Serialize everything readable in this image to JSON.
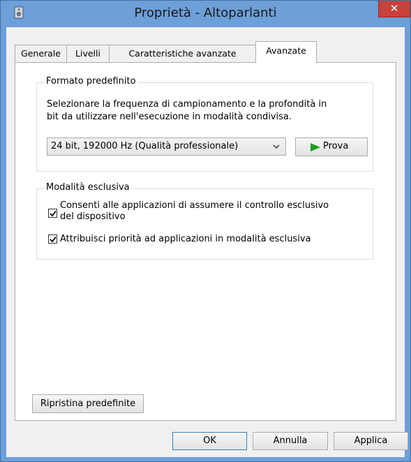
{
  "window": {
    "title": "Proprietà - Altoparlanti",
    "close_glyph": "✕"
  },
  "tabs": [
    {
      "label": "Generale"
    },
    {
      "label": "Livelli"
    },
    {
      "label": "Caratteristiche avanzate"
    },
    {
      "label": "Avanzate",
      "active": true
    }
  ],
  "default_format": {
    "legend": "Formato predefinito",
    "description_line1": "Selezionare la frequenza di campionamento e la profondità in",
    "description_line2": "bit da utilizzare nell'esecuzione in modalità condivisa.",
    "selected_value": "24 bit, 192000 Hz (Qualità professionale)",
    "test_button_label": "Prova",
    "test_icon": "play-icon",
    "play_color": "#1e9e1e"
  },
  "exclusive_mode": {
    "legend": "Modalità esclusiva",
    "options": [
      {
        "line1": "Consenti alle applicazioni di assumere il controllo esclusivo",
        "line2": "del dispositivo",
        "checked": true
      },
      {
        "line1": "Attribuisci priorità ad applicazioni in modalità esclusiva",
        "checked": true
      }
    ]
  },
  "restore_button_label": "Ripristina predefinite",
  "footer": {
    "ok_label": "OK",
    "cancel_label": "Annulla",
    "apply_label": "Applica"
  },
  "colors": {
    "titlebar": "#6d9fd8",
    "close_button": "#c7423a"
  }
}
